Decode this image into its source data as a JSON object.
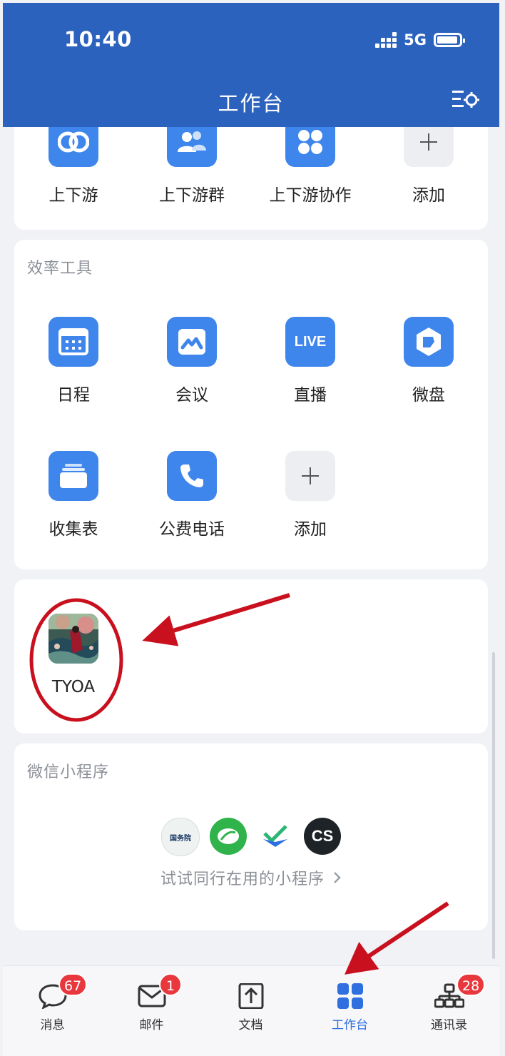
{
  "status_bar": {
    "time": "10:40",
    "network": "5G"
  },
  "header": {
    "title": "工作台",
    "settings_icon": "list-settings-icon"
  },
  "upstream_card": {
    "items": [
      {
        "label": "上下游",
        "icon": "link-icon"
      },
      {
        "label": "上下游群",
        "icon": "group-icon"
      },
      {
        "label": "上下游协作",
        "icon": "grid-icon"
      },
      {
        "label": "添加",
        "icon": "plus-icon"
      }
    ]
  },
  "efficiency_card": {
    "title": "效率工具",
    "items": [
      {
        "label": "日程",
        "icon": "calendar-icon"
      },
      {
        "label": "会议",
        "icon": "meeting-icon"
      },
      {
        "label": "直播",
        "icon": "live-icon",
        "icon_text": "LIVE"
      },
      {
        "label": "微盘",
        "icon": "drive-icon"
      },
      {
        "label": "收集表",
        "icon": "form-icon"
      },
      {
        "label": "公费电话",
        "icon": "phone-icon"
      },
      {
        "label": "添加",
        "icon": "plus-icon"
      }
    ]
  },
  "custom_app_card": {
    "items": [
      {
        "label": "TYOA",
        "icon": "tyoa-app-icon"
      }
    ]
  },
  "mini_program_card": {
    "title": "微信小程序",
    "icons": [
      {
        "name": "state-council-icon",
        "text": "国务院"
      },
      {
        "name": "leaf-icon",
        "text": ""
      },
      {
        "name": "check-icon",
        "text": ""
      },
      {
        "name": "cs-icon",
        "text": "CS"
      }
    ],
    "link_text": "试试同行在用的小程序"
  },
  "tabbar": {
    "tabs": [
      {
        "label": "消息",
        "badge": "67",
        "icon": "chat-icon"
      },
      {
        "label": "邮件",
        "badge": "1",
        "icon": "mail-icon"
      },
      {
        "label": "文档",
        "badge": "",
        "icon": "document-icon"
      },
      {
        "label": "工作台",
        "badge": "",
        "icon": "workbench-icon",
        "active": true
      },
      {
        "label": "通讯录",
        "badge": "28",
        "icon": "contacts-icon"
      }
    ]
  },
  "colors": {
    "header": "#2b62bd",
    "accent": "#3f86ec",
    "active_tab": "#2f6fe0",
    "badge": "#e8383d",
    "annotation": "#c8101e"
  }
}
